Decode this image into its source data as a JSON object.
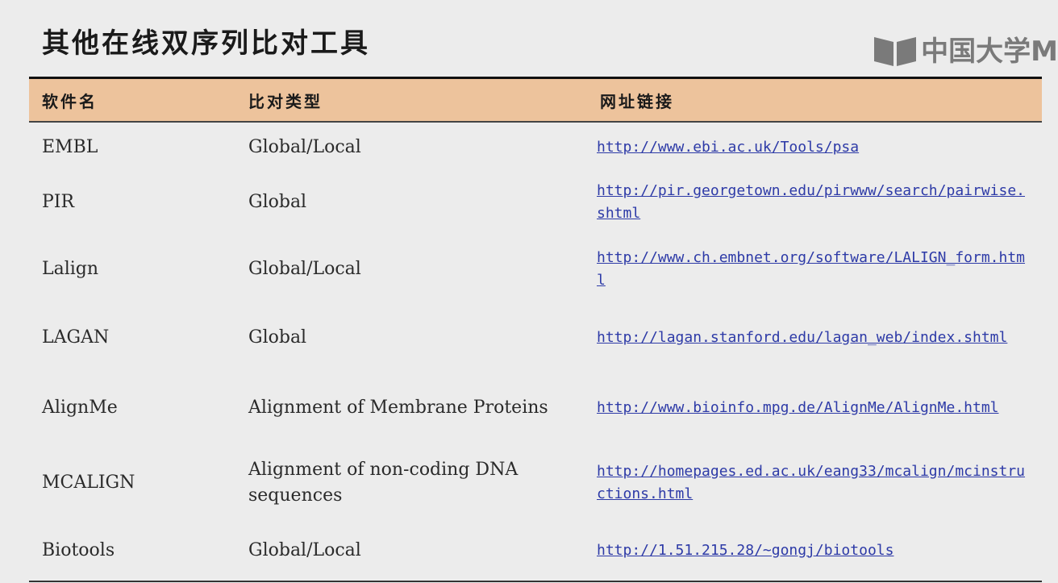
{
  "slide": {
    "title": "其他在线双序列比对工具",
    "logo_text": "中国大学M"
  },
  "table": {
    "headers": [
      "软件名",
      "比对类型",
      "网址链接"
    ],
    "rows": [
      {
        "name": "EMBL",
        "type": "Global/Local",
        "url": "http://www.ebi.ac.uk/Tools/psa"
      },
      {
        "name": "PIR",
        "type": "Global",
        "url": "http://pir.georgetown.edu/pirwww/search/pairwise.shtml"
      },
      {
        "name": "Lalign",
        "type": "Global/Local",
        "url": "http://www.ch.embnet.org/software/LALIGN_form.html"
      },
      {
        "name": "LAGAN",
        "type": "Global",
        "url": "http://lagan.stanford.edu/lagan_web/index.shtml"
      },
      {
        "name": "AlignMe",
        "type": "Alignment of Membrane Proteins",
        "url": "http://www.bioinfo.mpg.de/AlignMe/AlignMe.html"
      },
      {
        "name": "MCALIGN",
        "type": "Alignment of non-coding DNA sequences",
        "url": "http://homepages.ed.ac.uk/eang33/mcalign/mcinstructions.html"
      },
      {
        "name": "Biotools",
        "type": "Global/Local",
        "url": "http://1.51.215.28/~gongj/biotools"
      }
    ]
  },
  "colors": {
    "header_bg": "#edc39c",
    "link": "#2d3aa7",
    "background": "#ececec"
  }
}
